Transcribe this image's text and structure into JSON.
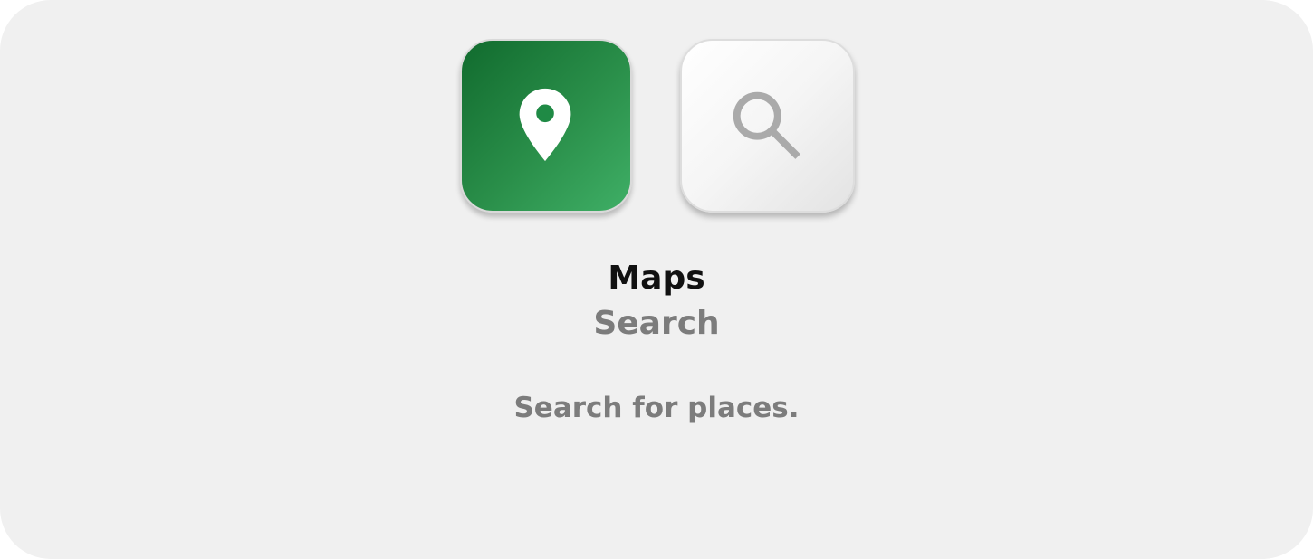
{
  "app": {
    "title": "Maps",
    "subtitle": "Search",
    "description": "Search for places."
  },
  "icons": {
    "app_icon": "map-pin-icon",
    "action_icon": "magnifier-search-icon"
  },
  "colors": {
    "background": "#f0f0f0",
    "maps_green_dark": "#116b2e",
    "maps_green_light": "#3faf66",
    "pin": "#ffffff",
    "magnifier": "#aaaaaa",
    "title_text": "#111111",
    "secondary_text": "#7c7c7c"
  }
}
